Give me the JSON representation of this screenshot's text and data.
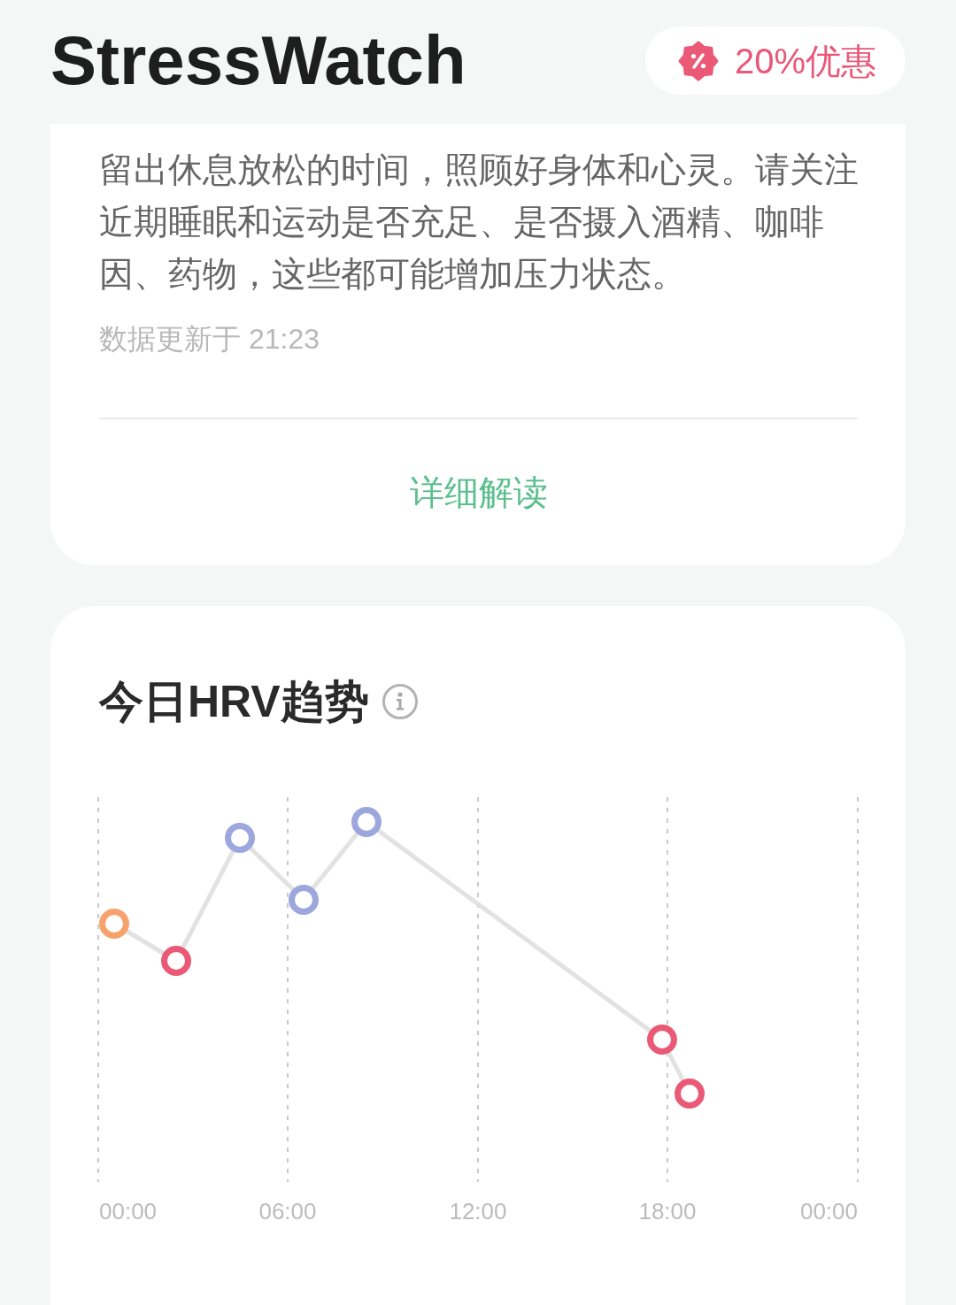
{
  "header": {
    "title": "StressWatch",
    "promo_badge": {
      "label": "20%优惠"
    }
  },
  "advice_card": {
    "paragraph": "留出休息放松的时间，照顾好身体和心灵。请关注近期睡眠和运动是否充足、是否摄入酒精、咖啡因、药物，这些都可能增加压力状态。",
    "updated": "数据更新于 21:23",
    "detail_button": "详细解读"
  },
  "hrv_card": {
    "title": "今日HRV趋势",
    "x_axis_labels": [
      "00:00",
      "06:00",
      "12:00",
      "18:00",
      "00:00"
    ],
    "points": [
      {
        "color": "#f7a26c"
      },
      {
        "color": "#ea5a76"
      },
      {
        "color": "#9ca7dd"
      },
      {
        "color": "#9ca7dd"
      },
      {
        "color": "#9ca7dd"
      },
      {
        "color": "#ea5a76"
      },
      {
        "color": "#ea5a76"
      }
    ]
  }
}
